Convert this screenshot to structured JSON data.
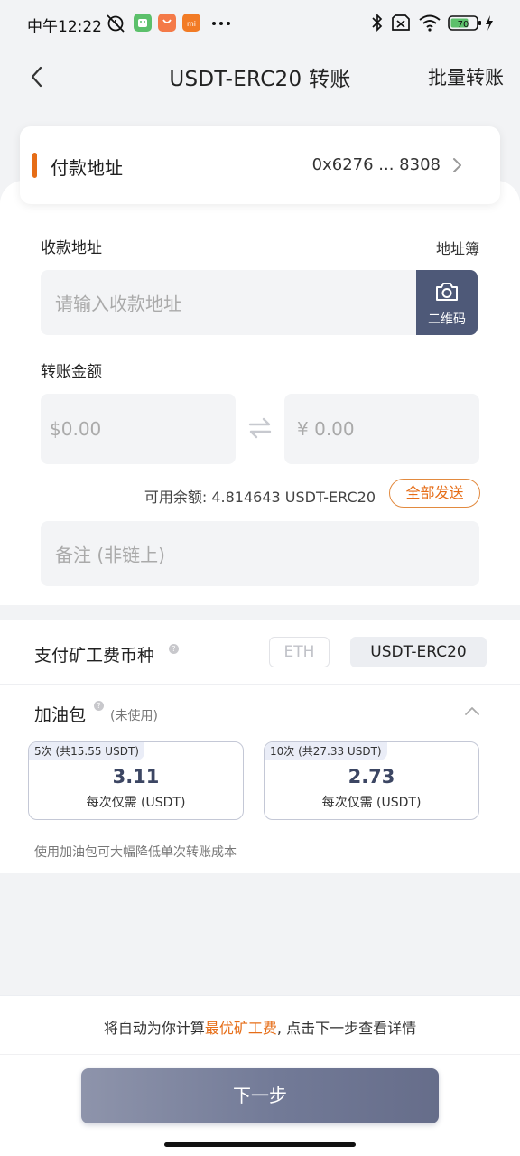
{
  "status_bar": {
    "time": "中午12:22",
    "battery_level": "70",
    "icons": [
      "alarm-off-icon",
      "android-icon",
      "taobao-icon",
      "mi-icon",
      "more-dots-icon",
      "bluetooth-icon",
      "no-sim-icon",
      "wifi-icon",
      "battery-icon",
      "charging-icon"
    ],
    "app_icon_mi_label": "mi"
  },
  "header": {
    "title": "USDT-ERC20 转账",
    "right_action": "批量转账"
  },
  "payer": {
    "label": "付款地址",
    "address": "0x6276 ... 8308"
  },
  "receiver": {
    "label": "收款地址",
    "address_book": "地址簿",
    "placeholder": "请输入收款地址",
    "qr_label": "二维码"
  },
  "amount": {
    "label": "转账金额",
    "usd_symbol": "$",
    "usd_value": "0.00",
    "cny_symbol": "¥",
    "cny_value": "0.00",
    "balance_text": "可用余额: 4.814643 USDT-ERC20",
    "send_all": "全部发送"
  },
  "memo": {
    "placeholder": "备注 (非链上)"
  },
  "fee_currency": {
    "label": "支付矿工费币种",
    "options": [
      "ETH",
      "USDT-ERC20"
    ],
    "selected": "USDT-ERC20"
  },
  "gas_pack": {
    "title": "加油包",
    "status": "(未使用)",
    "packages": [
      {
        "tag": "5次 (共15.55 USDT)",
        "price": "3.11",
        "sub": "每次仅需 (USDT)"
      },
      {
        "tag": "10次 (共27.33 USDT)",
        "price": "2.73",
        "sub": "每次仅需 (USDT)"
      }
    ],
    "hint": "使用加油包可大幅降低单次转账成本"
  },
  "footer": {
    "tip_before": "将自动为你计算",
    "tip_highlight": "最优矿工费",
    "tip_after": ", 点击下一步查看详情",
    "next_button": "下一步"
  },
  "colors": {
    "accent_orange": "#e66d17",
    "navy_button": "#4e5978",
    "page_bg": "#f2f3f5"
  }
}
